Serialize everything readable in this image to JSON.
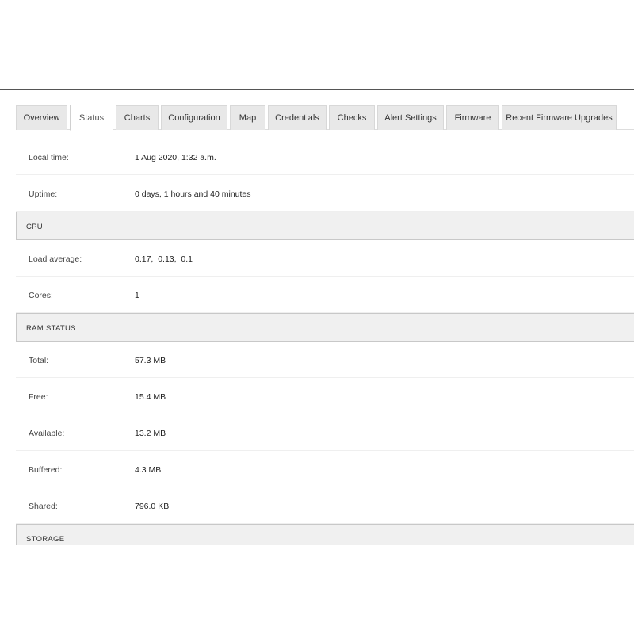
{
  "tabs": [
    {
      "label": "Overview",
      "active": false
    },
    {
      "label": "Status",
      "active": true
    },
    {
      "label": "Charts",
      "active": false
    },
    {
      "label": "Configuration",
      "active": false
    },
    {
      "label": "Map",
      "active": false
    },
    {
      "label": "Credentials",
      "active": false
    },
    {
      "label": "Checks",
      "active": false
    },
    {
      "label": "Alert Settings",
      "active": false
    },
    {
      "label": "Firmware",
      "active": false
    },
    {
      "label": "Recent Firmware Upgrades",
      "active": false
    }
  ],
  "general": {
    "local_time_label": "Local time:",
    "local_time_value": "1 Aug 2020, 1:32 a.m.",
    "uptime_label": "Uptime:",
    "uptime_value": "0 days, 1 hours and 40 minutes"
  },
  "cpu": {
    "title": "CPU",
    "load_label": "Load average:",
    "load_value": "0.17,  0.13,  0.1",
    "cores_label": "Cores:",
    "cores_value": "1"
  },
  "ram": {
    "title": "RAM STATUS",
    "total_label": "Total:",
    "total_value": "57.3 MB",
    "free_label": "Free:",
    "free_value": "15.4 MB",
    "available_label": "Available:",
    "available_value": "13.2 MB",
    "buffered_label": "Buffered:",
    "buffered_value": "4.3 MB",
    "shared_label": "Shared:",
    "shared_value": "796.0 KB"
  },
  "storage": {
    "title": "STORAGE"
  }
}
